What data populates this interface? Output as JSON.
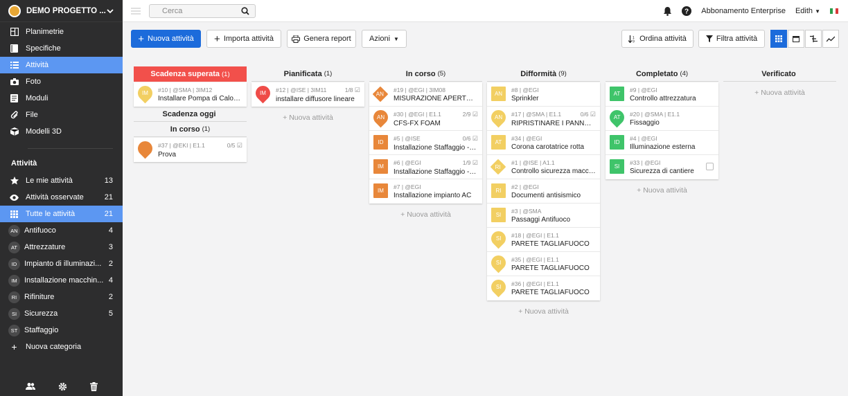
{
  "project": {
    "name": "DEMO PROGETTO ..."
  },
  "nav": [
    {
      "label": "Planimetrie",
      "icon": "floorplan-icon"
    },
    {
      "label": "Specifiche",
      "icon": "book-icon"
    },
    {
      "label": "Attività",
      "icon": "list-icon",
      "active": true
    },
    {
      "label": "Foto",
      "icon": "camera-icon"
    },
    {
      "label": "Moduli",
      "icon": "form-icon"
    },
    {
      "label": "File",
      "icon": "paperclip-icon"
    },
    {
      "label": "Modelli 3D",
      "icon": "cube-icon"
    }
  ],
  "activity_section": {
    "title": "Attività",
    "items": [
      {
        "label": "Le mie attività",
        "count": "13",
        "icon": "star-icon"
      },
      {
        "label": "Attività osservate",
        "count": "21",
        "icon": "eye-icon"
      },
      {
        "label": "Tutte le attività",
        "count": "21",
        "icon": "grid-icon",
        "active": true
      }
    ],
    "categories": [
      {
        "badge": "AN",
        "label": "Antifuoco",
        "count": "4"
      },
      {
        "badge": "AT",
        "label": "Attrezzature",
        "count": "3"
      },
      {
        "badge": "ID",
        "label": "Impianto di illuminazi...",
        "count": "2"
      },
      {
        "badge": "IM",
        "label": "Installazione macchin...",
        "count": "4"
      },
      {
        "badge": "RI",
        "label": "Rifiniture",
        "count": "2"
      },
      {
        "badge": "SI",
        "label": "Sicurezza",
        "count": "5"
      },
      {
        "badge": "ST",
        "label": "Staffaggio",
        "count": ""
      }
    ],
    "new_category": "Nuova categoria"
  },
  "topbar": {
    "search_placeholder": "Cerca",
    "plan": "Abbonamento Enterprise",
    "user": "Edith"
  },
  "toolbar": {
    "new": "Nuova attività",
    "import": "Importa attività",
    "report": "Genera report",
    "actions": "Azioni",
    "sort": "Ordina attività",
    "filter": "Filtra attività"
  },
  "new_activity_link": "+ Nuova attività",
  "colors": {
    "AN": "#e8873a",
    "AT": "#3fc46a",
    "ID": "#3fc46a",
    "IM": "#e8873a",
    "RI": "#f2cf62",
    "SI": "#f2cf62",
    "red": "#ef4c48",
    "primary": "#1c6bdb"
  },
  "columns": [
    {
      "title": "Scadenza superata",
      "count": "(1)",
      "red": true,
      "cards": [
        {
          "meta": "#10 | @SMA | 3IM12",
          "title": "Installare Pompa di Calore ...",
          "badge": "IM",
          "shape": "pin",
          "color": "#f2cf62"
        }
      ],
      "subsections": [
        {
          "title": "Scadenza oggi",
          "count": "",
          "cards": []
        },
        {
          "title": "In corso",
          "count": "(1)",
          "cards": [
            {
              "meta": "#37 | @EKI | E1.1",
              "prog": "0/5",
              "title": "Prova",
              "badge": "",
              "shape": "pin",
              "color": "#e8873a"
            }
          ]
        }
      ]
    },
    {
      "title": "Pianificata",
      "count": "(1)",
      "cards": [
        {
          "meta": "#12 | @ISE | 3IM11",
          "prog": "1/8",
          "title": "installare diffusore lineare",
          "badge": "IM",
          "shape": "pin",
          "color": "#ef4c48"
        }
      ],
      "add": true
    },
    {
      "title": "In corso",
      "count": "(5)",
      "cards": [
        {
          "meta": "#19 | @EGI | 3IM08",
          "title": "MISURAZIONE APERTUR...",
          "badge": "AN",
          "shape": "dia",
          "color": "#e8873a"
        },
        {
          "meta": "#30 | @EGI | E1.1",
          "prog": "2/9",
          "title": "CFS-FX FOAM",
          "badge": "AN",
          "shape": "pin",
          "color": "#e8873a"
        },
        {
          "meta": "#5 | @ISE",
          "prog": "0/6",
          "title": "Installazione Staffaggio -El...",
          "badge": "ID",
          "shape": "sq",
          "color": "#e8873a"
        },
        {
          "meta": "#6 | @EGI",
          "prog": "1/9",
          "title": "Installazione Staffaggio - M...",
          "badge": "IM",
          "shape": "sq",
          "color": "#e8873a"
        },
        {
          "meta": "#7 | @EGI",
          "title": "Installazione impianto AC",
          "badge": "IM",
          "shape": "sq",
          "color": "#e8873a"
        }
      ],
      "add": true
    },
    {
      "title": "Difformità",
      "count": "(9)",
      "cards": [
        {
          "meta": "#8 | @EGI",
          "title": "Sprinkler",
          "badge": "AN",
          "shape": "sq",
          "color": "#f2cf62"
        },
        {
          "meta": "#17 | @SMA | E1.1",
          "prog": "0/6",
          "title": "RIPRISTINARE I PANNELLI",
          "badge": "AN",
          "shape": "pin",
          "color": "#f2cf62"
        },
        {
          "meta": "#34 | @EGI",
          "title": "Corona carotatrice rotta",
          "badge": "AT",
          "shape": "sq",
          "color": "#f2cf62"
        },
        {
          "meta": "#1 | @ISE | A1.1",
          "title": "Controllo sicurezza macchi...",
          "badge": "RI",
          "shape": "dia",
          "color": "#f2cf62"
        },
        {
          "meta": "#2 | @EGI",
          "title": "Documenti antisismico",
          "badge": "RI",
          "shape": "sq",
          "color": "#f2cf62"
        },
        {
          "meta": "#3 | @SMA",
          "title": "Passaggi Antifuoco",
          "badge": "SI",
          "shape": "sq",
          "color": "#f2cf62"
        },
        {
          "meta": "#18 | @EGI | E1.1",
          "title": "PARETE TAGLIAFUOCO",
          "badge": "SI",
          "shape": "pin",
          "color": "#f2cf62"
        },
        {
          "meta": "#35 | @EGI | E1.1",
          "title": "PARETE TAGLIAFUOCO",
          "badge": "SI",
          "shape": "pin",
          "color": "#f2cf62"
        },
        {
          "meta": "#36 | @EGI | E1.1",
          "title": "PARETE TAGLIAFUOCO",
          "badge": "SI",
          "shape": "pin",
          "color": "#f2cf62"
        }
      ],
      "add": true
    },
    {
      "title": "Completato",
      "count": "(4)",
      "cards": [
        {
          "meta": "#9 | @EGI",
          "title": "Controllo attrezzatura",
          "badge": "AT",
          "shape": "sq",
          "color": "#3fc46a"
        },
        {
          "meta": "#20 | @SMA | E1.1",
          "title": "Fissaggio",
          "badge": "AT",
          "shape": "pin",
          "color": "#3fc46a"
        },
        {
          "meta": "#4 | @EGI",
          "title": "Illuminazione esterna",
          "badge": "ID",
          "shape": "sq",
          "color": "#3fc46a"
        },
        {
          "meta": "#33 | @EGI",
          "title": "Sicurezza di cantiere",
          "badge": "SI",
          "shape": "sq",
          "color": "#3fc46a",
          "checkbox": true
        }
      ],
      "add": true
    },
    {
      "title": "Verificato",
      "count": "",
      "cards": [],
      "add": true
    }
  ]
}
